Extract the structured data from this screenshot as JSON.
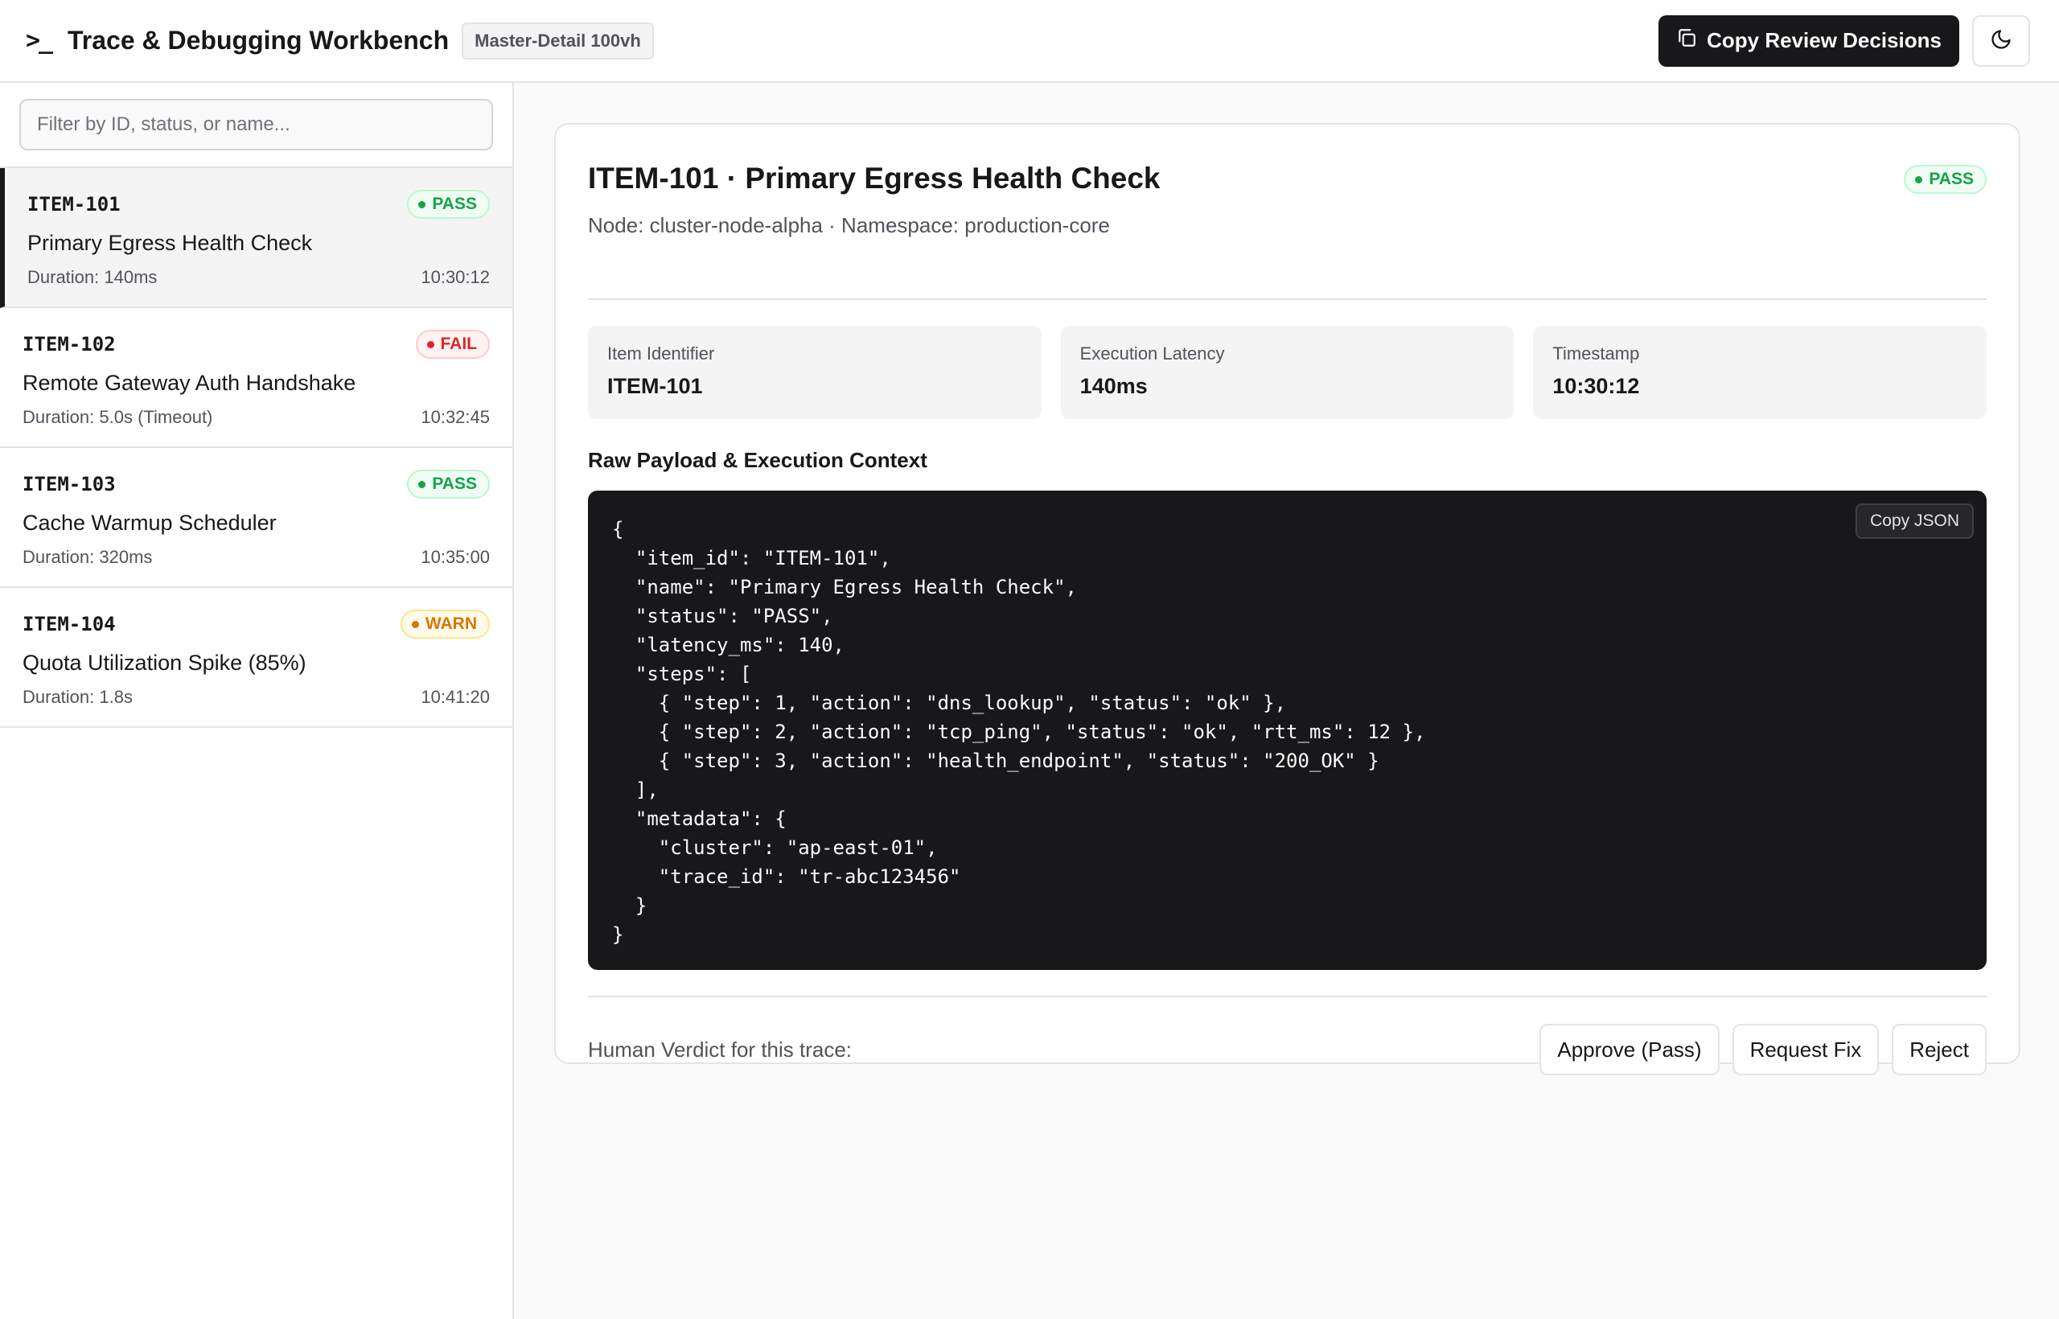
{
  "header": {
    "brand_icon": ">_",
    "title": "Trace & Debugging Workbench",
    "layout_badge": "Master-Detail 100vh",
    "copy_decisions_label": "Copy Review Decisions",
    "copy_icon": "copy-icon",
    "theme_icon": "moon-icon"
  },
  "sidebar": {
    "filter_placeholder": "Filter by ID, status, or name...",
    "filter_value": "",
    "items": [
      {
        "id": "ITEM-101",
        "status": "PASS",
        "name": "Primary Egress Health Check",
        "duration": "Duration: 140ms",
        "time": "10:30:12",
        "active": true
      },
      {
        "id": "ITEM-102",
        "status": "FAIL",
        "name": "Remote Gateway Auth Handshake",
        "duration": "Duration: 5.0s (Timeout)",
        "time": "10:32:45",
        "active": false
      },
      {
        "id": "ITEM-103",
        "status": "PASS",
        "name": "Cache Warmup Scheduler",
        "duration": "Duration: 320ms",
        "time": "10:35:00",
        "active": false
      },
      {
        "id": "ITEM-104",
        "status": "WARN",
        "name": "Quota Utilization Spike (85%)",
        "duration": "Duration: 1.8s",
        "time": "10:41:20",
        "active": false
      }
    ]
  },
  "detail": {
    "title": "ITEM-101 · Primary Egress Health Check",
    "subtitle": "Node: cluster-node-alpha · Namespace: production-core",
    "status": "PASS",
    "meta": [
      {
        "label": "Item Identifier",
        "value": "ITEM-101"
      },
      {
        "label": "Execution Latency",
        "value": "140ms"
      },
      {
        "label": "Timestamp",
        "value": "10:30:12"
      }
    ],
    "payload_title": "Raw Payload & Execution Context",
    "copy_json_label": "Copy JSON",
    "payload_json": "{\n  \"item_id\": \"ITEM-101\",\n  \"name\": \"Primary Egress Health Check\",\n  \"status\": \"PASS\",\n  \"latency_ms\": 140,\n  \"steps\": [\n    { \"step\": 1, \"action\": \"dns_lookup\", \"status\": \"ok\" },\n    { \"step\": 2, \"action\": \"tcp_ping\", \"status\": \"ok\", \"rtt_ms\": 12 },\n    { \"step\": 3, \"action\": \"health_endpoint\", \"status\": \"200_OK\" }\n  ],\n  \"metadata\": {\n    \"cluster\": \"ap-east-01\",\n    \"trace_id\": \"tr-abc123456\"\n  }\n}",
    "verdict_label": "Human Verdict for this trace:",
    "verdict_buttons": [
      "Approve (Pass)",
      "Request Fix",
      "Reject"
    ]
  },
  "colors": {
    "accent": "#18181b",
    "pass": "#16a34a",
    "fail": "#dc2626",
    "warn": "#d97706",
    "code_bg": "#18181b"
  }
}
